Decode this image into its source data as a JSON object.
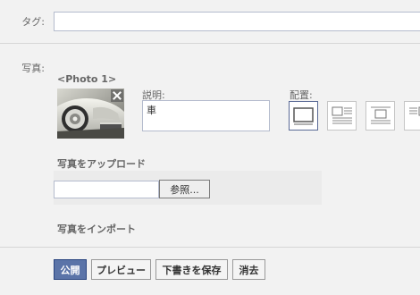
{
  "tag": {
    "label": "タグ:",
    "value": ""
  },
  "photo_section": {
    "label": "写真:",
    "photo_title": "<Photo 1>",
    "description_label": "説明:",
    "description_value": "車",
    "layout_label": "配置:",
    "layout_options": [
      "photo-only",
      "photo-left",
      "photo-center",
      "photo-right"
    ],
    "selected_layout": "photo-only"
  },
  "upload": {
    "title": "写真をアップロード",
    "file_value": "",
    "browse_label": "参照..."
  },
  "import": {
    "title": "写真をインポート"
  },
  "actions": {
    "publish_label": "公開",
    "preview_label": "プレビュー",
    "save_draft_label": "下書きを保存",
    "delete_label": "消去"
  },
  "colors": {
    "accent": "#5b74a8",
    "border": "#b4bbcd",
    "background": "#f2f2f2"
  }
}
